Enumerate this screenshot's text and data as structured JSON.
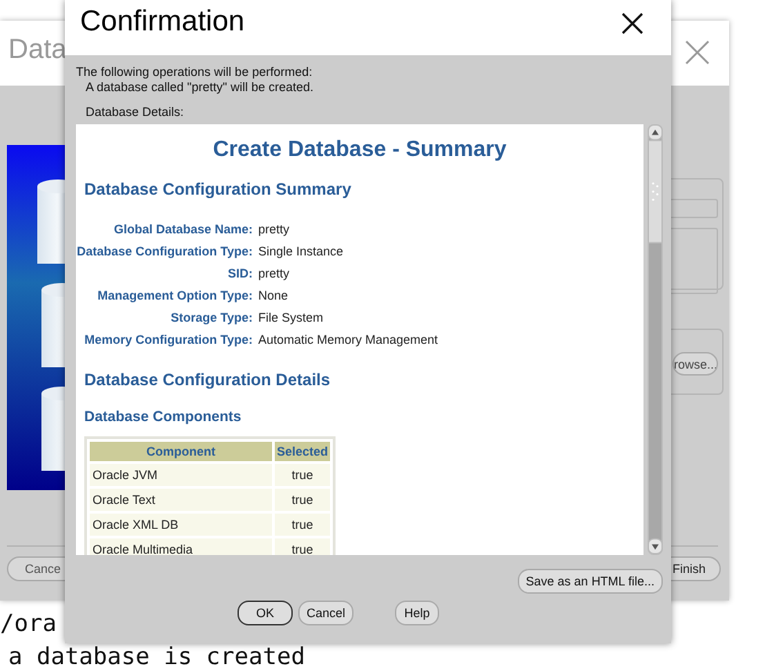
{
  "terminal": {
    "lines": [
      "/ora",
      "a database is created"
    ]
  },
  "background_window": {
    "title": "Data",
    "browse_button": "rowse...",
    "buttons": [
      {
        "label": "Cance",
        "kind": "left"
      },
      {
        "label": "Finish",
        "kind": "right"
      }
    ]
  },
  "dialog": {
    "title": "Confirmation",
    "intro": [
      "The following operations will be performed:",
      "A database called \"pretty\" will be created."
    ],
    "details_label": "Database Details:",
    "summary": {
      "title": "Create Database - Summary",
      "section": "Database Configuration Summary",
      "fields": [
        {
          "label": "Global Database Name:",
          "value": "pretty"
        },
        {
          "label": "Database Configuration Type:",
          "value": "Single Instance"
        },
        {
          "label": "SID:",
          "value": "pretty"
        },
        {
          "label": "Management Option Type:",
          "value": "None"
        },
        {
          "label": "Storage Type:",
          "value": "File System"
        },
        {
          "label": "Memory Configuration Type:",
          "value": "Automatic Memory Management"
        }
      ],
      "details_section": "Database Configuration Details",
      "components_section": "Database Components",
      "table": {
        "columns": [
          "Component",
          "Selected"
        ],
        "rows": [
          [
            "Oracle JVM",
            "true"
          ],
          [
            "Oracle Text",
            "true"
          ],
          [
            "Oracle XML DB",
            "true"
          ],
          [
            "Oracle Multimedia",
            "true"
          ]
        ]
      }
    },
    "save_button": "Save as an HTML file...",
    "buttons": [
      {
        "label": "OK",
        "default": true
      },
      {
        "label": "Cancel",
        "default": false
      },
      {
        "label": "Help",
        "default": false
      }
    ]
  }
}
